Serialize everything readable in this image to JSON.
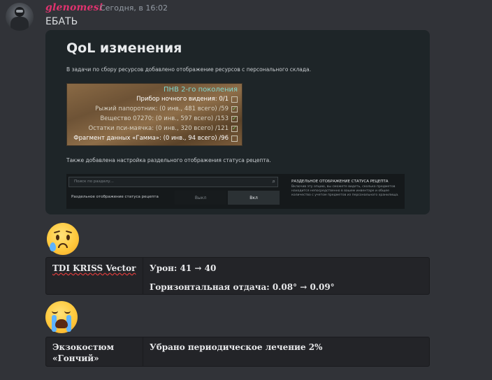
{
  "message": {
    "username": "glenomesi",
    "timestamp": "Сегодня, в 16:02",
    "text": "ЕБАТЬ"
  },
  "embed": {
    "title": "QoL изменения",
    "text1": "В задачи по сбору ресурсов добавлено отображение ресурсов с персонального склада.",
    "hud": {
      "title": "ПНВ 2-го поколения",
      "rows": [
        {
          "text": "Прибор ночного видения: 0/1",
          "checked": false
        },
        {
          "text": "Рыжий папоротник: (0 инв., 481 всего) /59",
          "checked": true
        },
        {
          "text": "Вещество 07270: (0 инв., 597 всего) /153",
          "checked": true
        },
        {
          "text": "Остатки пси-маячка: (0 инв., 320 всего) /121",
          "checked": true
        },
        {
          "text": "Фрагмент данных «Гамма»: (0 инв., 94 всего) /96",
          "checked": false
        }
      ]
    },
    "text2": "Также добавлена настройка раздельного отображения статуса рецепта.",
    "settings": {
      "search_placeholder": "Поиск по разделу...",
      "option_label": "Раздельное отображение статуса рецепта",
      "off_label": "Выкл",
      "on_label": "Вкл",
      "side_title": "РАЗДЕЛЬНОЕ ОТОБРАЖЕНИЕ СТАТУСА РЕЦЕПТА",
      "side_desc": "Включив эту опцию, вы сможете видеть, сколько предметов находится непосредственно в вашем инвентаре и общее количество с учетом предметов из персонального хранилища."
    }
  },
  "table1": {
    "name": "TDI KRISS Vector",
    "line1": "Урон: 41 → 40",
    "line2": "Горизонтальная отдача: 0.08° → 0.09°"
  },
  "table2": {
    "name_line1": "Экзокостюм",
    "name_line2": "«Гончий»",
    "text": "Убрано периодическое лечение 2%"
  },
  "colors": {
    "background": "#313338",
    "username": "#e0336f",
    "hud_title": "#7fd9d0"
  }
}
